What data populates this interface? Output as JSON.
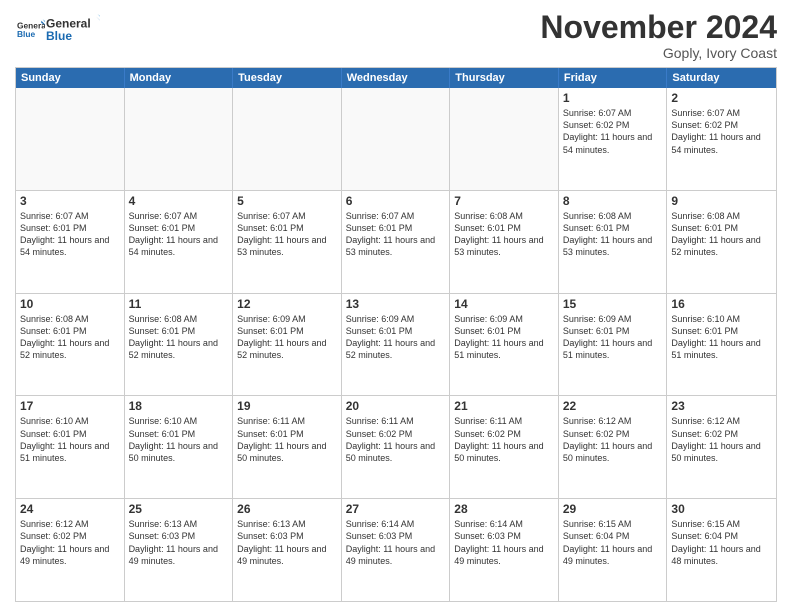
{
  "logo": {
    "general": "General",
    "blue": "Blue"
  },
  "header": {
    "month": "November 2024",
    "location": "Goply, Ivory Coast"
  },
  "weekdays": [
    "Sunday",
    "Monday",
    "Tuesday",
    "Wednesday",
    "Thursday",
    "Friday",
    "Saturday"
  ],
  "weeks": [
    [
      {
        "day": "",
        "text": ""
      },
      {
        "day": "",
        "text": ""
      },
      {
        "day": "",
        "text": ""
      },
      {
        "day": "",
        "text": ""
      },
      {
        "day": "",
        "text": ""
      },
      {
        "day": "1",
        "text": "Sunrise: 6:07 AM\nSunset: 6:02 PM\nDaylight: 11 hours and 54 minutes."
      },
      {
        "day": "2",
        "text": "Sunrise: 6:07 AM\nSunset: 6:02 PM\nDaylight: 11 hours and 54 minutes."
      }
    ],
    [
      {
        "day": "3",
        "text": "Sunrise: 6:07 AM\nSunset: 6:01 PM\nDaylight: 11 hours and 54 minutes."
      },
      {
        "day": "4",
        "text": "Sunrise: 6:07 AM\nSunset: 6:01 PM\nDaylight: 11 hours and 54 minutes."
      },
      {
        "day": "5",
        "text": "Sunrise: 6:07 AM\nSunset: 6:01 PM\nDaylight: 11 hours and 53 minutes."
      },
      {
        "day": "6",
        "text": "Sunrise: 6:07 AM\nSunset: 6:01 PM\nDaylight: 11 hours and 53 minutes."
      },
      {
        "day": "7",
        "text": "Sunrise: 6:08 AM\nSunset: 6:01 PM\nDaylight: 11 hours and 53 minutes."
      },
      {
        "day": "8",
        "text": "Sunrise: 6:08 AM\nSunset: 6:01 PM\nDaylight: 11 hours and 53 minutes."
      },
      {
        "day": "9",
        "text": "Sunrise: 6:08 AM\nSunset: 6:01 PM\nDaylight: 11 hours and 52 minutes."
      }
    ],
    [
      {
        "day": "10",
        "text": "Sunrise: 6:08 AM\nSunset: 6:01 PM\nDaylight: 11 hours and 52 minutes."
      },
      {
        "day": "11",
        "text": "Sunrise: 6:08 AM\nSunset: 6:01 PM\nDaylight: 11 hours and 52 minutes."
      },
      {
        "day": "12",
        "text": "Sunrise: 6:09 AM\nSunset: 6:01 PM\nDaylight: 11 hours and 52 minutes."
      },
      {
        "day": "13",
        "text": "Sunrise: 6:09 AM\nSunset: 6:01 PM\nDaylight: 11 hours and 52 minutes."
      },
      {
        "day": "14",
        "text": "Sunrise: 6:09 AM\nSunset: 6:01 PM\nDaylight: 11 hours and 51 minutes."
      },
      {
        "day": "15",
        "text": "Sunrise: 6:09 AM\nSunset: 6:01 PM\nDaylight: 11 hours and 51 minutes."
      },
      {
        "day": "16",
        "text": "Sunrise: 6:10 AM\nSunset: 6:01 PM\nDaylight: 11 hours and 51 minutes."
      }
    ],
    [
      {
        "day": "17",
        "text": "Sunrise: 6:10 AM\nSunset: 6:01 PM\nDaylight: 11 hours and 51 minutes."
      },
      {
        "day": "18",
        "text": "Sunrise: 6:10 AM\nSunset: 6:01 PM\nDaylight: 11 hours and 50 minutes."
      },
      {
        "day": "19",
        "text": "Sunrise: 6:11 AM\nSunset: 6:01 PM\nDaylight: 11 hours and 50 minutes."
      },
      {
        "day": "20",
        "text": "Sunrise: 6:11 AM\nSunset: 6:02 PM\nDaylight: 11 hours and 50 minutes."
      },
      {
        "day": "21",
        "text": "Sunrise: 6:11 AM\nSunset: 6:02 PM\nDaylight: 11 hours and 50 minutes."
      },
      {
        "day": "22",
        "text": "Sunrise: 6:12 AM\nSunset: 6:02 PM\nDaylight: 11 hours and 50 minutes."
      },
      {
        "day": "23",
        "text": "Sunrise: 6:12 AM\nSunset: 6:02 PM\nDaylight: 11 hours and 50 minutes."
      }
    ],
    [
      {
        "day": "24",
        "text": "Sunrise: 6:12 AM\nSunset: 6:02 PM\nDaylight: 11 hours and 49 minutes."
      },
      {
        "day": "25",
        "text": "Sunrise: 6:13 AM\nSunset: 6:03 PM\nDaylight: 11 hours and 49 minutes."
      },
      {
        "day": "26",
        "text": "Sunrise: 6:13 AM\nSunset: 6:03 PM\nDaylight: 11 hours and 49 minutes."
      },
      {
        "day": "27",
        "text": "Sunrise: 6:14 AM\nSunset: 6:03 PM\nDaylight: 11 hours and 49 minutes."
      },
      {
        "day": "28",
        "text": "Sunrise: 6:14 AM\nSunset: 6:03 PM\nDaylight: 11 hours and 49 minutes."
      },
      {
        "day": "29",
        "text": "Sunrise: 6:15 AM\nSunset: 6:04 PM\nDaylight: 11 hours and 49 minutes."
      },
      {
        "day": "30",
        "text": "Sunrise: 6:15 AM\nSunset: 6:04 PM\nDaylight: 11 hours and 48 minutes."
      }
    ]
  ]
}
